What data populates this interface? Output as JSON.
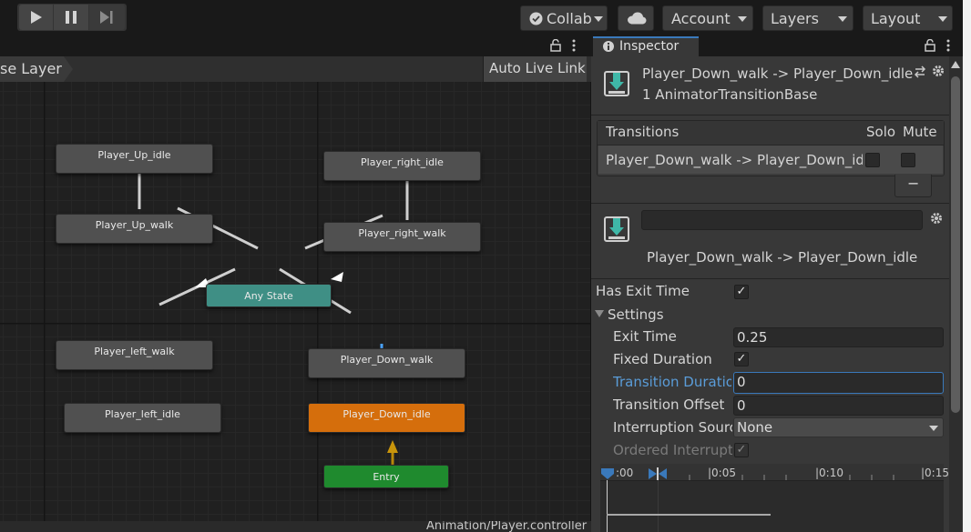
{
  "toolbar": {
    "play_icon": "play-icon",
    "pause_icon": "pause-icon",
    "step_icon": "step-icon",
    "collab_label": "Collab",
    "cloud_icon": "cloud-icon",
    "account_label": "Account",
    "layers_label": "Layers",
    "layout_label": "Layout"
  },
  "animator": {
    "breadcrumb": "se Layer",
    "auto_live_link": "Auto Live Link",
    "footer_path": "Animation/Player.controller",
    "states": {
      "up_idle": "Player_Up_idle",
      "up_walk": "Player_Up_walk",
      "right_idle": "Player_right_idle",
      "right_walk": "Player_right_walk",
      "any_state": "Any State",
      "left_walk": "Player_left_walk",
      "left_idle": "Player_left_idle",
      "down_walk": "Player_Down_walk",
      "down_idle": "Player_Down_idle",
      "entry": "Entry"
    }
  },
  "inspector": {
    "tab_label": "Inspector",
    "title": "Player_Down_walk -> Player_Down_idle",
    "subtitle": "1 AnimatorTransitionBase",
    "transitions_header": "Transitions",
    "solo_header": "Solo",
    "mute_header": "Mute",
    "transition_item": "Player_Down_walk -> Player_Down_idle",
    "remove_button": "−",
    "name_field_value": "",
    "transition_name": "Player_Down_walk -> Player_Down_idle",
    "has_exit_time_label": "Has Exit Time",
    "settings_label": "Settings",
    "exit_time_label": "Exit Time",
    "exit_time_value": "0.25",
    "fixed_duration_label": "Fixed Duration",
    "transition_duration_label": "Transition Duration",
    "transition_duration_value": "0",
    "transition_offset_label": "Transition Offset",
    "transition_offset_value": "0",
    "interruption_source_label": "Interruption Source",
    "interruption_source_value": "None",
    "ordered_interruption_label": "Ordered Interruption",
    "timeline_ticks": [
      ":00",
      "|0:05",
      "|0:10",
      "|0:15"
    ]
  },
  "colors": {
    "any_state": "#3f8f85",
    "default_state": "#d56e0c",
    "entry": "#1f8a2e",
    "accent": "#3a79bb"
  }
}
